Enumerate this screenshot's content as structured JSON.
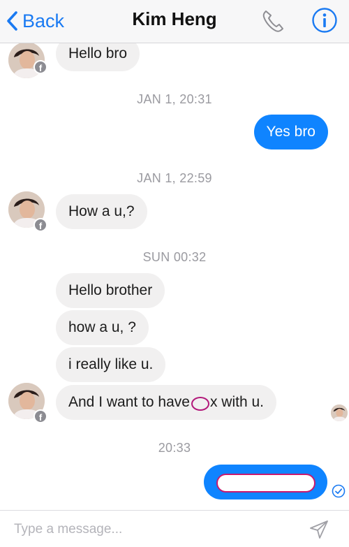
{
  "header": {
    "back_label": "Back",
    "contact_name": "Kim Heng",
    "call_icon": "phone-icon",
    "info_icon": "info-icon"
  },
  "colors": {
    "accent": "#1a7af2",
    "outgoing_bubble": "#0f84ff",
    "incoming_bubble": "#f1f0f0",
    "timestamp": "#9a9aa0"
  },
  "messages": [
    {
      "direction": "incoming",
      "text": "Hello bro"
    },
    {
      "timestamp": "JAN 1, 20:31"
    },
    {
      "direction": "outgoing",
      "text": "Yes bro"
    },
    {
      "timestamp": "JAN 1, 22:59"
    },
    {
      "direction": "incoming",
      "text": "How a u,?"
    },
    {
      "timestamp": "SUN 00:32"
    },
    {
      "direction": "incoming",
      "text": "Hello brother"
    },
    {
      "direction": "incoming",
      "text": "how a u, ?"
    },
    {
      "direction": "incoming",
      "text": "i really like u."
    },
    {
      "direction": "incoming",
      "text_before": "And I want to have",
      "text_after": "x with u."
    },
    {
      "timestamp": "20:33"
    },
    {
      "direction": "outgoing",
      "text": "",
      "status": "delivered"
    }
  ],
  "composer": {
    "placeholder": "Type a message...",
    "send_icon": "send-icon"
  }
}
